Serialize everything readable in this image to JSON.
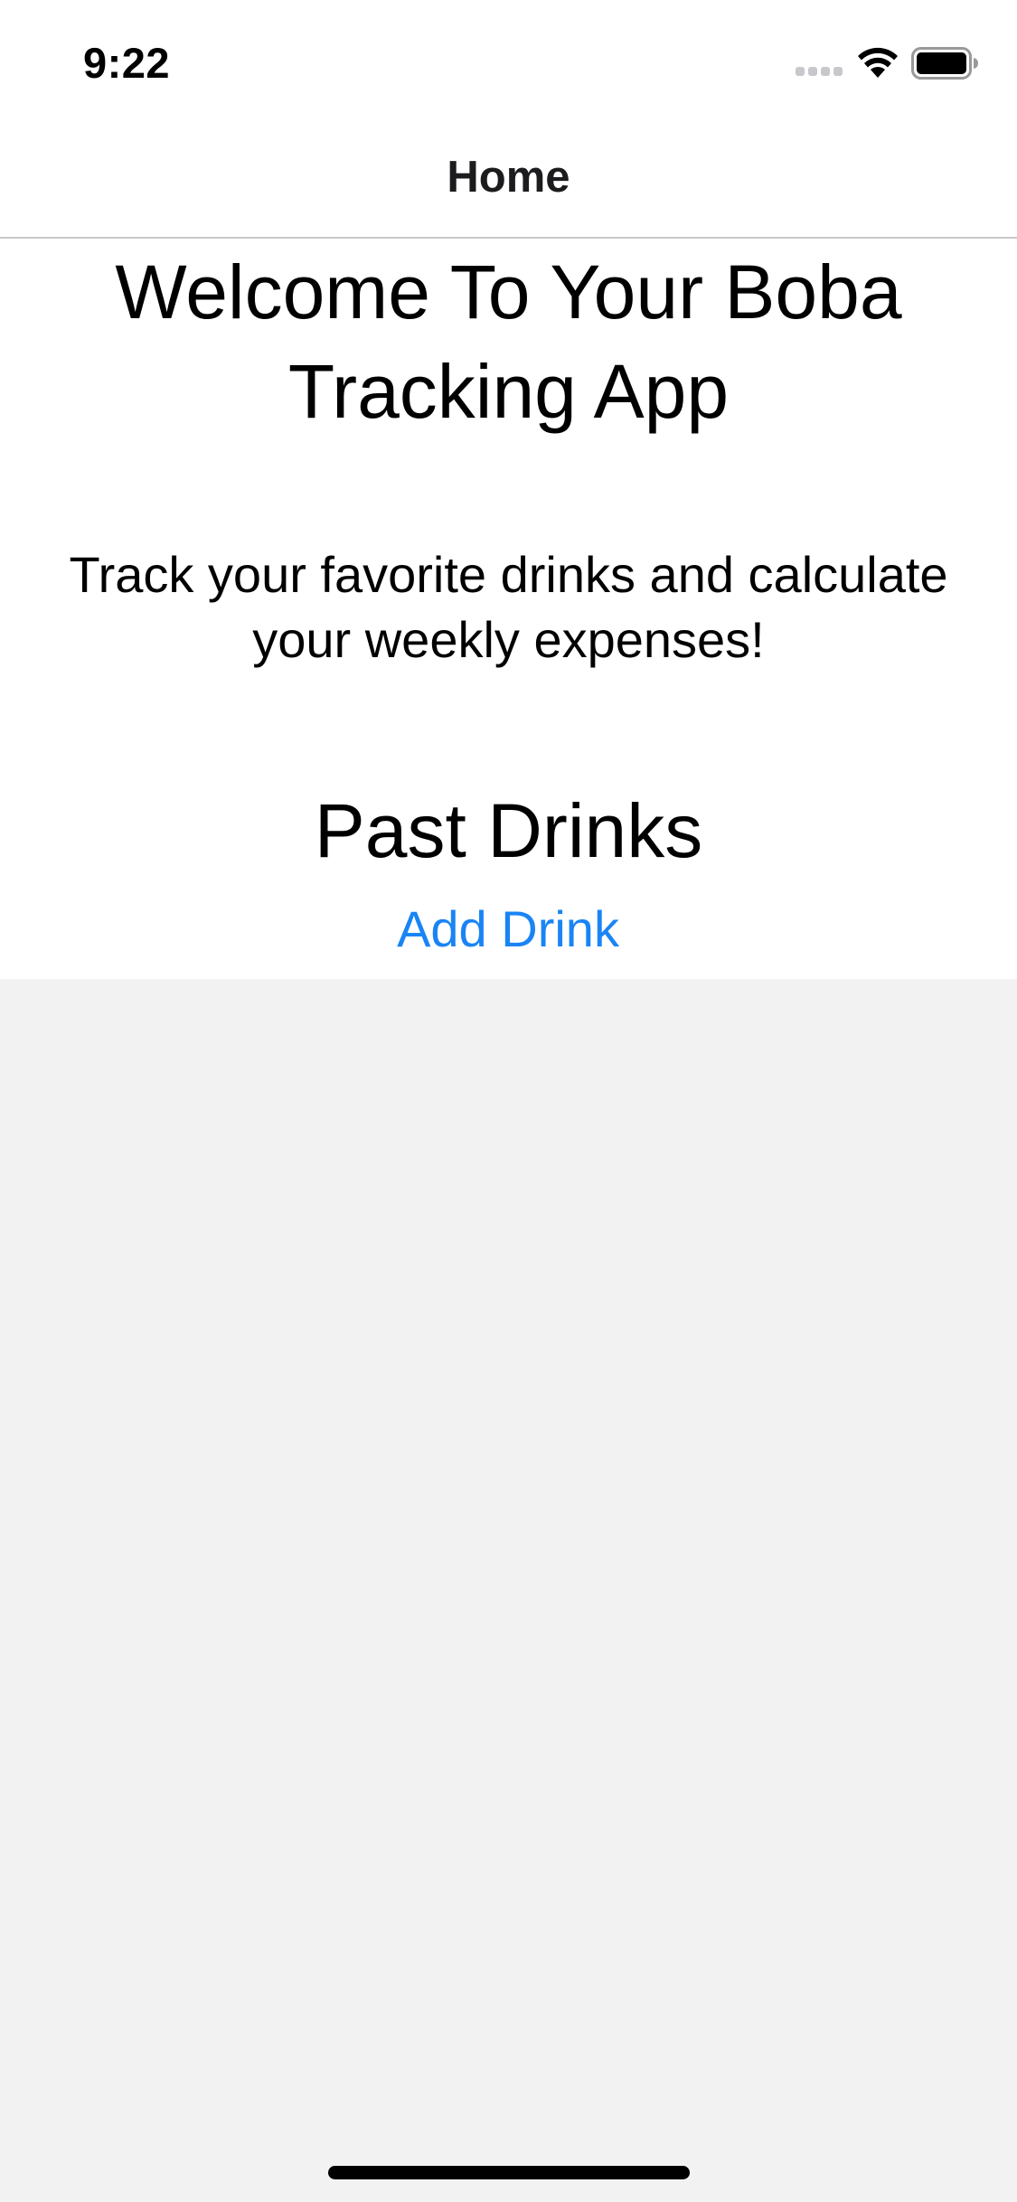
{
  "status_bar": {
    "time": "9:22",
    "icons": [
      "signal-icon",
      "wifi-icon",
      "battery-icon"
    ]
  },
  "nav_bar": {
    "title": "Home"
  },
  "main": {
    "welcome_title": "Welcome To Your Boba Tracking App",
    "subtitle": "Track your favorite drinks and calculate your weekly expenses!",
    "section_title": "Past Drinks",
    "add_button_label": "Add Drink"
  },
  "colors": {
    "accent": "#1a84f5",
    "page_background": "#f2f2f2",
    "content_background": "#ffffff"
  }
}
